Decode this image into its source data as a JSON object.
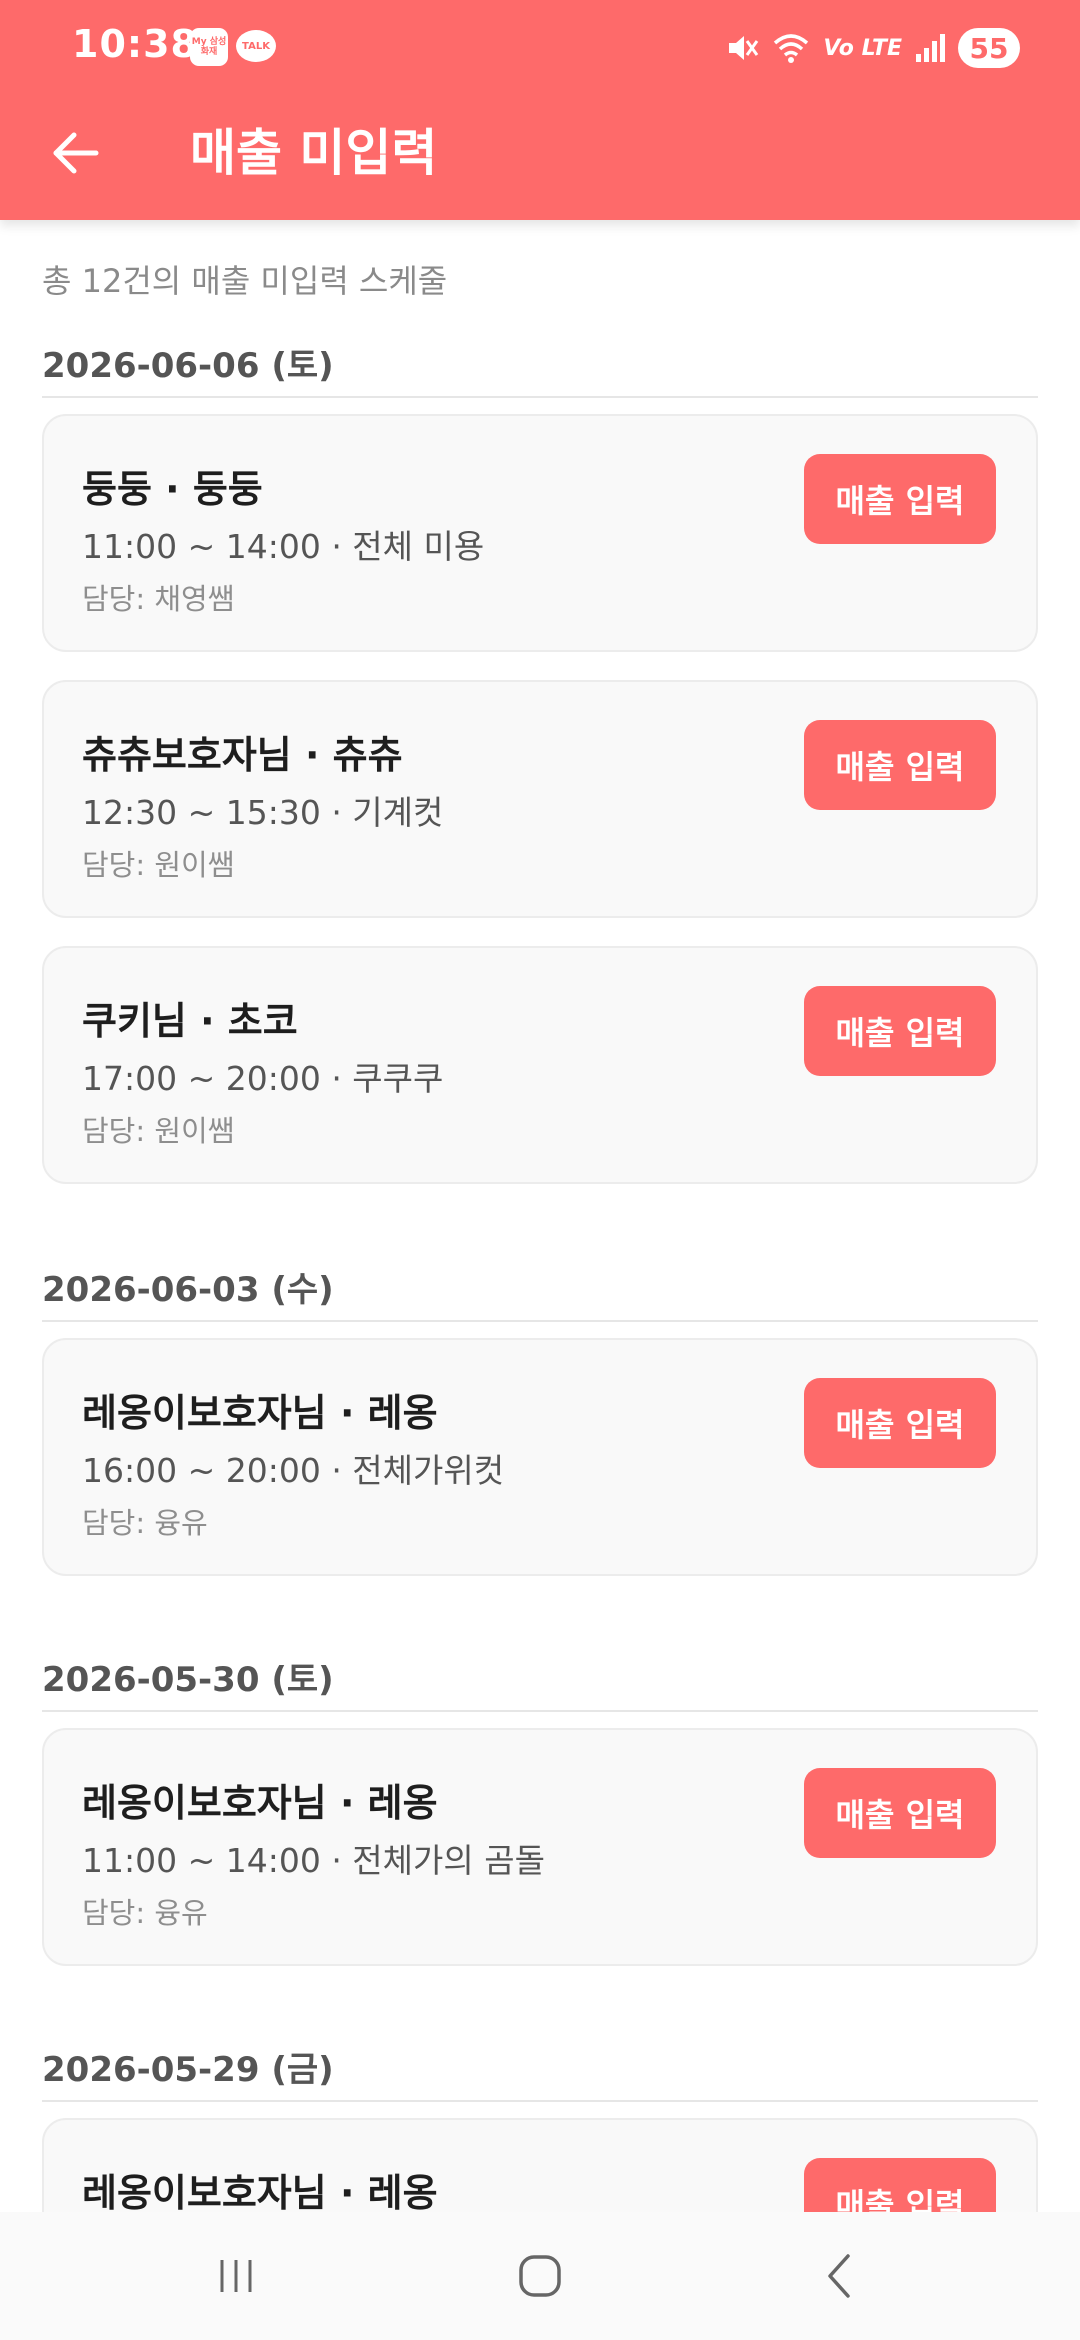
{
  "status": {
    "time": "10:38",
    "app_icon_label": "My 삼성화재",
    "talk_label": "TALK",
    "network": "Vo LTE",
    "battery": "55"
  },
  "header": {
    "title": "매출 미입력"
  },
  "summary": "총 12건의 매출 미입력 스케줄",
  "sales_button_label": "매출 입력",
  "groups": [
    {
      "date": "2026-06-06 (토)",
      "items": [
        {
          "title": "둥둥 · 둥둥",
          "time": "11:00 ~ 14:00 · 전체 미용",
          "staff": "담당: 채영쌤"
        },
        {
          "title": "츄츄보호자님 · 츄츄",
          "time": "12:30 ~ 15:30 · 기계컷",
          "staff": "담당: 원이쌤"
        },
        {
          "title": "쿠키님 · 초코",
          "time": "17:00 ~ 20:00 · 쿠쿠쿠",
          "staff": "담당: 원이쌤"
        }
      ]
    },
    {
      "date": "2026-06-03 (수)",
      "items": [
        {
          "title": "레옹이보호자님 · 레옹",
          "time": "16:00 ~ 20:00 · 전체가위컷",
          "staff": "담당: 융유"
        }
      ]
    },
    {
      "date": "2026-05-30 (토)",
      "items": [
        {
          "title": "레옹이보호자님 · 레옹",
          "time": "11:00 ~ 14:00 · 전체가의 곰돌",
          "staff": "담당: 융유"
        }
      ]
    },
    {
      "date": "2026-05-29 (금)",
      "items": [
        {
          "title": "레옹이보호자님 · 레옹",
          "time": "",
          "staff": ""
        }
      ]
    }
  ],
  "colors": {
    "accent": "#fe6a6a",
    "card_bg": "#f9f9f9",
    "text_primary": "#1e1e1e",
    "text_secondary": "#555555",
    "text_muted": "#8e8e8e"
  },
  "icons": {
    "back": "arrow-left-icon",
    "nav_recents": "recents-icon",
    "nav_home": "home-icon",
    "nav_back": "chevron-left-icon"
  }
}
